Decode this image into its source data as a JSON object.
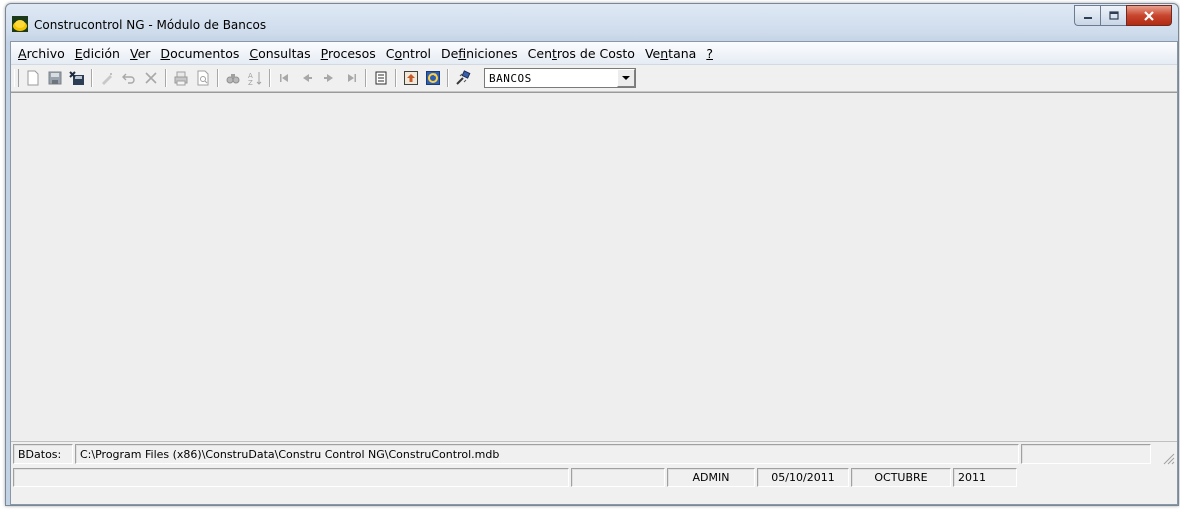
{
  "window": {
    "title": "Construcontrol NG - Módulo de Bancos"
  },
  "menu": [
    {
      "key": "A",
      "rest": "rchivo"
    },
    {
      "key": "E",
      "rest": "dición"
    },
    {
      "key": "V",
      "rest": "er"
    },
    {
      "key": "D",
      "rest": "ocumentos"
    },
    {
      "key": "C",
      "rest": "onsultas"
    },
    {
      "key": "P",
      "rest": "rocesos"
    },
    {
      "pre": "C",
      "key": "o",
      "rest": "ntrol"
    },
    {
      "pre": "De",
      "key": "f",
      "rest": "iniciones"
    },
    {
      "pre": "Cen",
      "key": "t",
      "rest": "ros de Costo"
    },
    {
      "pre": "Ve",
      "key": "n",
      "rest": "tana"
    },
    {
      "key": "?",
      "rest": ""
    }
  ],
  "toolbar": {
    "buttons": [
      "new-icon",
      "save-icon",
      "save-close-icon",
      "edit-icon",
      "undo-icon",
      "delete-icon",
      "print-icon",
      "print-preview-icon",
      "find-icon",
      "sort-icon",
      "first-record-icon",
      "previous-record-icon",
      "next-record-icon",
      "last-record-icon",
      "list-icon",
      "export-icon",
      "refresh-icon",
      "connect-icon"
    ],
    "module_select": "BANCOS"
  },
  "status": {
    "db_label": "BDatos:",
    "db_path": "C:\\Program Files (x86)\\ConstruData\\Constru Control NG\\ConstruControl.mdb",
    "user": "ADMIN",
    "date": "05/10/2011",
    "month": "OCTUBRE",
    "year": "2011"
  },
  "colors": {
    "titlebar": "#cfdcec",
    "close_button": "#c8462e",
    "workspace": "#eeeeee"
  }
}
